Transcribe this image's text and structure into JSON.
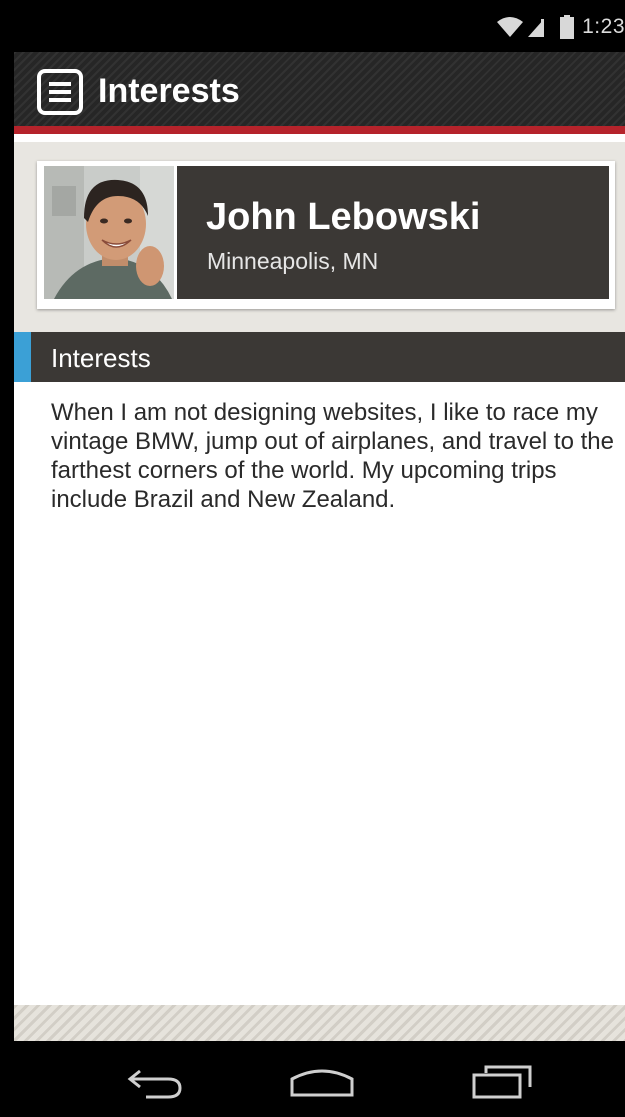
{
  "status_bar": {
    "time": "1:23",
    "icons": [
      "wifi-icon",
      "signal-icon",
      "battery-icon"
    ]
  },
  "action_bar": {
    "title": "Interests",
    "menu_icon": "menu-icon",
    "accent_color": "#b5232b"
  },
  "profile": {
    "name": "John Lebowski",
    "location": "Minneapolis, MN",
    "avatar_icon": "avatar-photo"
  },
  "section": {
    "title": "Interests",
    "accent_color": "#3ba0d6"
  },
  "bio": "When I am not designing websites, I like to race my vintage BMW, jump out of airplanes, and travel to the farthest corners of the world.  My upcoming trips include Brazil and New Zealand.",
  "nav_bar": {
    "buttons": [
      "back-icon",
      "home-icon",
      "recent-apps-icon"
    ]
  }
}
